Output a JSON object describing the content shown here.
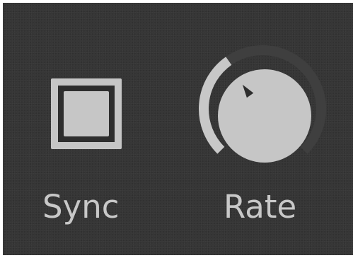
{
  "controls": {
    "sync": {
      "label": "Sync",
      "active": false
    },
    "rate": {
      "label": "Rate",
      "value_fraction": 0.37
    }
  },
  "colors": {
    "background": "#353535",
    "control_light": "#c6c6c6",
    "control_dark": "#2e2e2e",
    "arc_track": "#3f3f3f",
    "arc_fill": "#c8c8c8",
    "label_text": "#c8c8c8"
  }
}
